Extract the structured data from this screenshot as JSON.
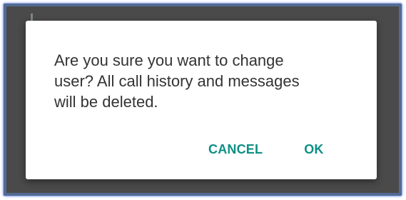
{
  "dialog": {
    "message": "Are you sure you want to change\nuser? All call history and messages\nwill be deleted.",
    "cancel_label": "CANCEL",
    "ok_label": "OK",
    "accent_color": "#0e8f84"
  }
}
